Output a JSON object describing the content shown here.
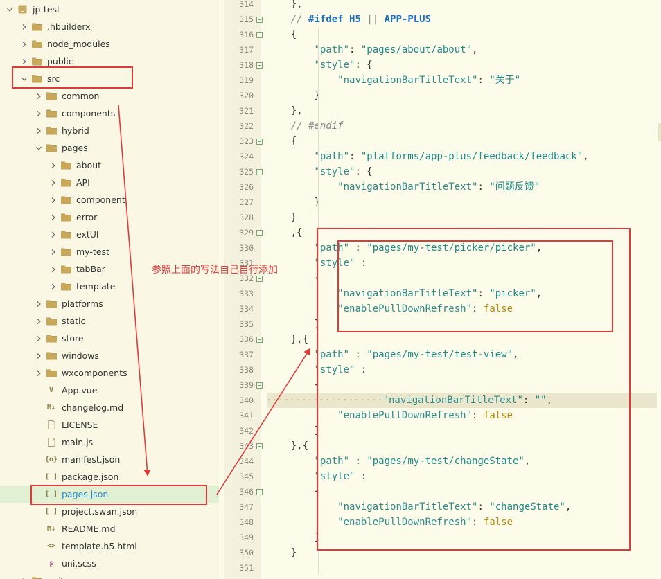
{
  "sidebar": {
    "items": [
      {
        "name": "jp-test",
        "type": "project",
        "depth": 0,
        "expanded": true
      },
      {
        "name": ".hbuilderx",
        "type": "folder",
        "depth": 1,
        "expanded": false
      },
      {
        "name": "node_modules",
        "type": "folder",
        "depth": 1,
        "expanded": false
      },
      {
        "name": "public",
        "type": "folder",
        "depth": 1,
        "expanded": false
      },
      {
        "name": "src",
        "type": "folder",
        "depth": 1,
        "expanded": true
      },
      {
        "name": "common",
        "type": "folder",
        "depth": 2,
        "expanded": false
      },
      {
        "name": "components",
        "type": "folder",
        "depth": 2,
        "expanded": false
      },
      {
        "name": "hybrid",
        "type": "folder",
        "depth": 2,
        "expanded": false
      },
      {
        "name": "pages",
        "type": "folder",
        "depth": 2,
        "expanded": true
      },
      {
        "name": "about",
        "type": "folder",
        "depth": 3,
        "expanded": false
      },
      {
        "name": "API",
        "type": "folder",
        "depth": 3,
        "expanded": false
      },
      {
        "name": "component",
        "type": "folder",
        "depth": 3,
        "expanded": false
      },
      {
        "name": "error",
        "type": "folder",
        "depth": 3,
        "expanded": false
      },
      {
        "name": "extUI",
        "type": "folder",
        "depth": 3,
        "expanded": false
      },
      {
        "name": "my-test",
        "type": "folder",
        "depth": 3,
        "expanded": false
      },
      {
        "name": "tabBar",
        "type": "folder",
        "depth": 3,
        "expanded": false
      },
      {
        "name": "template",
        "type": "folder",
        "depth": 3,
        "expanded": false
      },
      {
        "name": "platforms",
        "type": "folder",
        "depth": 2,
        "expanded": false
      },
      {
        "name": "static",
        "type": "folder",
        "depth": 2,
        "expanded": false
      },
      {
        "name": "store",
        "type": "folder",
        "depth": 2,
        "expanded": false
      },
      {
        "name": "windows",
        "type": "folder",
        "depth": 2,
        "expanded": false
      },
      {
        "name": "wxcomponents",
        "type": "folder",
        "depth": 2,
        "expanded": false
      },
      {
        "name": "App.vue",
        "type": "vue",
        "depth": 2
      },
      {
        "name": "changelog.md",
        "type": "md",
        "depth": 2
      },
      {
        "name": "LICENSE",
        "type": "file",
        "depth": 2
      },
      {
        "name": "main.js",
        "type": "js",
        "depth": 2
      },
      {
        "name": "manifest.json",
        "type": "manifest",
        "depth": 2
      },
      {
        "name": "package.json",
        "type": "json",
        "depth": 2
      },
      {
        "name": "pages.json",
        "type": "json",
        "depth": 2,
        "selected": true
      },
      {
        "name": "project.swan.json",
        "type": "json",
        "depth": 2
      },
      {
        "name": "README.md",
        "type": "md",
        "depth": 2
      },
      {
        "name": "template.h5.html",
        "type": "html",
        "depth": 2
      },
      {
        "name": "uni.scss",
        "type": "scss",
        "depth": 2
      },
      {
        "name": "units",
        "type": "folder",
        "depth": 1,
        "expanded": false
      }
    ]
  },
  "annotation": {
    "note": "参照上面的写法自己自行添加"
  },
  "editor": {
    "lines": [
      {
        "n": "314",
        "fold": false,
        "tokens": [
          [
            "p",
            "    },"
          ]
        ]
      },
      {
        "n": "315",
        "fold": true,
        "tokens": [
          [
            "c",
            "    // "
          ],
          [
            "kw",
            "#ifdef"
          ],
          [
            "c",
            " "
          ],
          [
            "kw",
            "H5"
          ],
          [
            "c",
            " || "
          ],
          [
            "kw",
            "APP-PLUS"
          ]
        ]
      },
      {
        "n": "316",
        "fold": true,
        "tokens": [
          [
            "p",
            "    {"
          ]
        ]
      },
      {
        "n": "317",
        "fold": false,
        "tokens": [
          [
            "p",
            "        "
          ],
          [
            "k",
            "\"path\""
          ],
          [
            "p",
            ": "
          ],
          [
            "s",
            "\"pages/about/about\""
          ],
          [
            "p",
            ","
          ]
        ]
      },
      {
        "n": "318",
        "fold": true,
        "tokens": [
          [
            "p",
            "        "
          ],
          [
            "k",
            "\"style\""
          ],
          [
            "p",
            ": {"
          ]
        ]
      },
      {
        "n": "319",
        "fold": false,
        "tokens": [
          [
            "p",
            "            "
          ],
          [
            "k",
            "\"navigationBarTitleText\""
          ],
          [
            "p",
            ": "
          ],
          [
            "s",
            "\"关于\""
          ]
        ]
      },
      {
        "n": "320",
        "fold": false,
        "tokens": [
          [
            "p",
            "        }"
          ]
        ]
      },
      {
        "n": "321",
        "fold": false,
        "tokens": [
          [
            "p",
            "    },"
          ]
        ]
      },
      {
        "n": "322",
        "fold": false,
        "tokens": [
          [
            "c",
            "    // #endif"
          ]
        ]
      },
      {
        "n": "323",
        "fold": true,
        "tokens": [
          [
            "p",
            "    {"
          ]
        ]
      },
      {
        "n": "324",
        "fold": false,
        "tokens": [
          [
            "p",
            "        "
          ],
          [
            "k",
            "\"path\""
          ],
          [
            "p",
            ": "
          ],
          [
            "s",
            "\"platforms/app-plus/feedback/feedback\""
          ],
          [
            "p",
            ","
          ]
        ]
      },
      {
        "n": "325",
        "fold": true,
        "tokens": [
          [
            "p",
            "        "
          ],
          [
            "k",
            "\"style\""
          ],
          [
            "p",
            ": {"
          ]
        ]
      },
      {
        "n": "326",
        "fold": false,
        "tokens": [
          [
            "p",
            "            "
          ],
          [
            "k",
            "\"navigationBarTitleText\""
          ],
          [
            "p",
            ": "
          ],
          [
            "s",
            "\"问题反馈\""
          ]
        ]
      },
      {
        "n": "327",
        "fold": false,
        "tokens": [
          [
            "p",
            "        }"
          ]
        ]
      },
      {
        "n": "328",
        "fold": false,
        "tokens": [
          [
            "p",
            "    }"
          ]
        ]
      },
      {
        "n": "329",
        "fold": true,
        "tokens": [
          [
            "p",
            "    ,{"
          ]
        ]
      },
      {
        "n": "330",
        "fold": false,
        "tokens": [
          [
            "p",
            "        "
          ],
          [
            "k",
            "\"path\""
          ],
          [
            "p",
            " : "
          ],
          [
            "s",
            "\"pages/my-test/picker/picker\""
          ],
          [
            "p",
            ","
          ]
        ]
      },
      {
        "n": "331",
        "fold": false,
        "tokens": [
          [
            "p",
            "        "
          ],
          [
            "k",
            "\"style\""
          ],
          [
            "p",
            " :"
          ]
        ]
      },
      {
        "n": "332",
        "fold": true,
        "tokens": [
          [
            "p",
            "        {"
          ]
        ]
      },
      {
        "n": "333",
        "fold": false,
        "tokens": [
          [
            "p",
            "            "
          ],
          [
            "k",
            "\"navigationBarTitleText\""
          ],
          [
            "p",
            ": "
          ],
          [
            "s",
            "\"picker\""
          ],
          [
            "p",
            ","
          ]
        ]
      },
      {
        "n": "334",
        "fold": false,
        "tokens": [
          [
            "p",
            "            "
          ],
          [
            "k",
            "\"enablePullDownRefresh\""
          ],
          [
            "p",
            ": "
          ],
          [
            "b",
            "false"
          ]
        ]
      },
      {
        "n": "335",
        "fold": false,
        "tokens": [
          [
            "p",
            "        }"
          ]
        ]
      },
      {
        "n": "336",
        "fold": true,
        "tokens": [
          [
            "p",
            "    },{"
          ]
        ]
      },
      {
        "n": "337",
        "fold": false,
        "tokens": [
          [
            "p",
            "        "
          ],
          [
            "k",
            "\"path\""
          ],
          [
            "p",
            " : "
          ],
          [
            "s",
            "\"pages/my-test/test-view\""
          ],
          [
            "p",
            ","
          ]
        ]
      },
      {
        "n": "338",
        "fold": false,
        "tokens": [
          [
            "p",
            "        "
          ],
          [
            "k",
            "\"style\""
          ],
          [
            "p",
            " :"
          ]
        ]
      },
      {
        "n": "339",
        "fold": true,
        "tokens": [
          [
            "p",
            "        {"
          ]
        ]
      },
      {
        "n": "340",
        "fold": false,
        "hl": true,
        "tokens": [
          [
            "dots",
            "····················"
          ],
          [
            "k",
            "\"navigationBarTitleText\""
          ],
          [
            "p",
            ": "
          ],
          [
            "s",
            "\"\""
          ],
          [
            "p",
            ","
          ]
        ]
      },
      {
        "n": "341",
        "fold": false,
        "tokens": [
          [
            "p",
            "            "
          ],
          [
            "k",
            "\"enablePullDownRefresh\""
          ],
          [
            "p",
            ": "
          ],
          [
            "b",
            "false"
          ]
        ]
      },
      {
        "n": "342",
        "fold": false,
        "tokens": [
          [
            "p",
            "        }"
          ]
        ]
      },
      {
        "n": "343",
        "fold": true,
        "tokens": [
          [
            "p",
            "    },{"
          ]
        ]
      },
      {
        "n": "344",
        "fold": false,
        "tokens": [
          [
            "p",
            "        "
          ],
          [
            "k",
            "\"path\""
          ],
          [
            "p",
            " : "
          ],
          [
            "s",
            "\"pages/my-test/changeState\""
          ],
          [
            "p",
            ","
          ]
        ]
      },
      {
        "n": "345",
        "fold": false,
        "tokens": [
          [
            "p",
            "        "
          ],
          [
            "k",
            "\"style\""
          ],
          [
            "p",
            " :"
          ]
        ]
      },
      {
        "n": "346",
        "fold": true,
        "tokens": [
          [
            "p",
            "        {"
          ]
        ]
      },
      {
        "n": "347",
        "fold": false,
        "tokens": [
          [
            "p",
            "            "
          ],
          [
            "k",
            "\"navigationBarTitleText\""
          ],
          [
            "p",
            ": "
          ],
          [
            "s",
            "\"changeState\""
          ],
          [
            "p",
            ","
          ]
        ]
      },
      {
        "n": "348",
        "fold": false,
        "tokens": [
          [
            "p",
            "            "
          ],
          [
            "k",
            "\"enablePullDownRefresh\""
          ],
          [
            "p",
            ": "
          ],
          [
            "b",
            "false"
          ]
        ]
      },
      {
        "n": "349",
        "fold": false,
        "tokens": [
          [
            "p",
            "        }"
          ]
        ]
      },
      {
        "n": "350",
        "fold": false,
        "tokens": [
          [
            "p",
            "    }"
          ]
        ]
      },
      {
        "n": "351",
        "fold": false,
        "tokens": [
          [
            "p",
            ""
          ]
        ]
      }
    ]
  },
  "colors": {
    "annotation_red": "#e03b3b",
    "selection_green": "#e1efd2",
    "selected_text_blue": "#2a8fd8",
    "folder_tan": "#c9a85a"
  }
}
